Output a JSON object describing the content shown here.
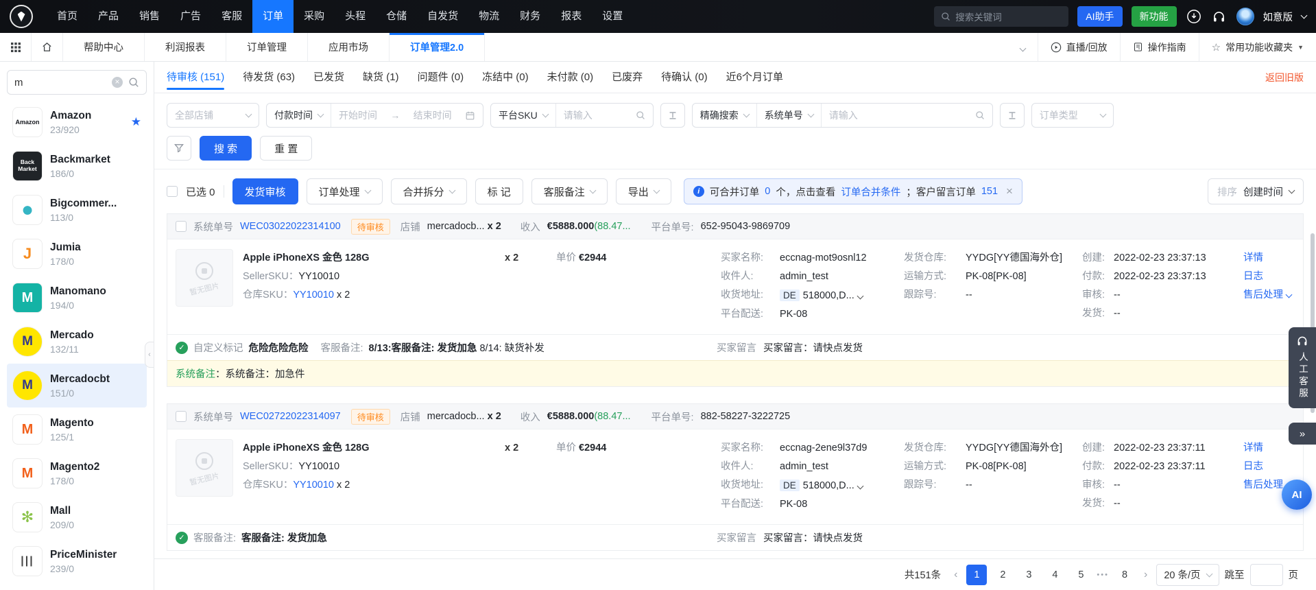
{
  "colors": {
    "accent": "#2468f2",
    "nav_active": "#1677ff",
    "success_green": "#27a05c",
    "badge_orange": "#ff8c21",
    "back_link_orange": "#f2552b",
    "new_feature_green": "#25a244"
  },
  "topnav": {
    "items": [
      "首页",
      "产品",
      "销售",
      "广告",
      "客服",
      "订单",
      "采购",
      "头程",
      "仓储",
      "自发货",
      "物流",
      "财务",
      "报表",
      "设置"
    ],
    "search_placeholder": "搜索关键词",
    "ai_assistant": "AI助手",
    "new_feature": "新功能",
    "edition": "如意版"
  },
  "tabbar": {
    "tabs": [
      "帮助中心",
      "利润报表",
      "订单管理",
      "应用市场",
      "订单管理2.0"
    ],
    "live": "直播/回放",
    "guide": "操作指南",
    "favorites": "常用功能收藏夹"
  },
  "sidebar": {
    "search_value": "m",
    "items": [
      {
        "name": "Amazon",
        "count": "23/920",
        "logo_text": "Amazon",
        "logo_style": "background:#fff;color:#16191f;font-size:9px;font-weight:bold"
      },
      {
        "name": "Backmarket",
        "count": "186/0",
        "logo_text": "Back Market",
        "logo_style": "background:#202428;color:#fff;font-size:8.5px;font-weight:bold;line-height:1.15"
      },
      {
        "name": "Bigcommer...",
        "count": "113/0",
        "logo_text": "●",
        "logo_style": "background:#fff;color:#35b5c4;font-size:30px"
      },
      {
        "name": "Jumia",
        "count": "178/0",
        "logo_text": "J",
        "logo_style": "background:#fff;color:#f68b1e;font-size:22px;font-weight:bold"
      },
      {
        "name": "Manomano",
        "count": "194/0",
        "logo_text": "M",
        "logo_style": "background:#14b3a5;color:#fff;font-size:20px;font-weight:bold"
      },
      {
        "name": "Mercado",
        "count": "132/11",
        "logo_text": "M",
        "logo_style": "background:#ffe600;color:#33398c;font-size:19px;font-weight:bold;border-radius:50%"
      },
      {
        "name": "Mercadocbt",
        "count": "151/0",
        "logo_text": "M",
        "logo_style": "background:#ffe600;color:#33398c;font-size:19px;font-weight:bold;border-radius:50%"
      },
      {
        "name": "Magento",
        "count": "125/1",
        "logo_text": "M",
        "logo_style": "background:#fff;color:#f2611c;font-size:20px;font-weight:bold"
      },
      {
        "name": "Magento2",
        "count": "178/0",
        "logo_text": "M",
        "logo_style": "background:#fff;color:#f2611c;font-size:20px;font-weight:bold"
      },
      {
        "name": "Mall",
        "count": "209/0",
        "logo_text": "✻",
        "logo_style": "background:#fff;color:#8bc34a;font-size:22px"
      },
      {
        "name": "PriceMinister",
        "count": "239/0",
        "logo_text": "|||",
        "logo_style": "background:#fff;color:#444;font-size:16px;font-weight:bold;letter-spacing:2px"
      }
    ]
  },
  "status_tabs": {
    "tabs": [
      "待审核 (151)",
      "待发货 (63)",
      "已发货",
      "缺货 (1)",
      "问题件 (0)",
      "冻结中 (0)",
      "未付款 (0)",
      "已废弃",
      "待确认 (0)",
      "近6个月订单"
    ],
    "back_old": "返回旧版"
  },
  "filters": {
    "shop_all": "全部店铺",
    "pay_time": "付款时间",
    "start_time": "开始时间",
    "range_arrow": "→",
    "end_time": "结束时间",
    "platform_sku": "平台SKU",
    "input_placeholder": "请输入",
    "exact_search": "精确搜索",
    "system_no": "系统单号",
    "order_type": "订单类型",
    "search_btn": "搜 索",
    "reset_btn": "重 置"
  },
  "toolbar": {
    "selected_text": "已选 0",
    "audit": "发货审核",
    "process": "订单处理",
    "merge_split": "合并拆分",
    "mark": "标 记",
    "cs_note": "客服备注",
    "export": "导出",
    "alert": {
      "pre": "可合并订单",
      "count": "0",
      "mid": "个，点击查看",
      "link": "订单合并条件",
      "sep": "；客户留言订单",
      "count2": "151",
      "close": "×"
    },
    "sort_label": "排序",
    "sort_value": "创建时间"
  },
  "orders": [
    {
      "order_no_label": "系统单号",
      "order_no": "WEC03022022314100",
      "status": "待审核",
      "shop_label": "店铺",
      "shop": "mercadocb...",
      "shop_qty": "x 2",
      "income_label": "收入",
      "income": "€5888.000",
      "income_rate": "(88.47...",
      "platform_no_label": "平台单号:",
      "platform_no": "652-95043-9869709",
      "product": {
        "no_image_text": "暂无图片",
        "title": "Apple iPhoneXS 金色 128G",
        "seller_sku_label": "SellerSKU：",
        "seller_sku": "YY10010",
        "wh_sku_label": "仓库SKU：",
        "wh_sku": "YY10010",
        "wh_sku_qty": "x 2",
        "qty": "x 2",
        "price_label": "单价",
        "price": "€2944"
      },
      "buyer": {
        "name_label": "买家名称:",
        "name": "eccnag-mot9osnl12",
        "recipient_label": "收件人:",
        "recipient": "admin_test",
        "address_label": "收货地址:",
        "country": "DE",
        "address": "518000,D...",
        "delivery_label": "平台配送:",
        "delivery": "PK-08"
      },
      "shipping": {
        "warehouse_label": "发货仓库:",
        "warehouse": "YYDG[YY德国海外仓]",
        "method_label": "运输方式:",
        "method": "PK-08[PK-08]",
        "tracking_label": "跟踪号:",
        "tracking": "--"
      },
      "times": {
        "created_label": "创建:",
        "created": "2022-02-23 23:37:13",
        "paid_label": "付款:",
        "paid": "2022-02-23 23:37:13",
        "audited_label": "审核:",
        "audited": "--",
        "shipped_label": "发货:",
        "shipped": "--"
      },
      "links": {
        "detail": "详情",
        "log": "日志",
        "aftersale": "售后处理"
      },
      "tags": {
        "custom_label": "自定义标记",
        "custom_value": "危险危险危险",
        "cs_label": "客服备注:",
        "cs_value_bold": "8/13:客服备注: 发货加急",
        "cs_value_rest": " 8/14: 缺货补发",
        "buyer_label": "买家留言",
        "buyer_value": "买家留言：请快点发货"
      },
      "system_note_label": "系统备注",
      "system_note": "：系统备注：加急件"
    },
    {
      "order_no_label": "系统单号",
      "order_no": "WEC02722022314097",
      "status": "待审核",
      "shop_label": "店铺",
      "shop": "mercadocb...",
      "shop_qty": "x 2",
      "income_label": "收入",
      "income": "€5888.000",
      "income_rate": "(88.47...",
      "platform_no_label": "平台单号:",
      "platform_no": "882-58227-3222725",
      "product": {
        "no_image_text": "暂无图片",
        "title": "Apple iPhoneXS 金色 128G",
        "seller_sku_label": "SellerSKU：",
        "seller_sku": "YY10010",
        "wh_sku_label": "仓库SKU：",
        "wh_sku": "YY10010",
        "wh_sku_qty": "x 2",
        "qty": "x 2",
        "price_label": "单价",
        "price": "€2944"
      },
      "buyer": {
        "name_label": "买家名称:",
        "name": "eccnag-2ene9l37d9",
        "recipient_label": "收件人:",
        "recipient": "admin_test",
        "address_label": "收货地址:",
        "country": "DE",
        "address": "518000,D...",
        "delivery_label": "平台配送:",
        "delivery": "PK-08"
      },
      "shipping": {
        "warehouse_label": "发货仓库:",
        "warehouse": "YYDG[YY德国海外仓]",
        "method_label": "运输方式:",
        "method": "PK-08[PK-08]",
        "tracking_label": "跟踪号:",
        "tracking": "--"
      },
      "times": {
        "created_label": "创建:",
        "created": "2022-02-23 23:37:11",
        "paid_label": "付款:",
        "paid": "2022-02-23 23:37:11",
        "audited_label": "审核:",
        "audited": "--",
        "shipped_label": "发货:",
        "shipped": "--"
      },
      "links": {
        "detail": "详情",
        "log": "日志",
        "aftersale": "售后处理"
      },
      "tags": {
        "cs_label": "客服备注:",
        "cs_value_bold": "客服备注: 发货加急",
        "cs_value_rest": "",
        "buyer_label": "买家留言",
        "buyer_value": "买家留言：请快点发货"
      }
    }
  ],
  "footer": {
    "total": "共151条",
    "prev_icon": "‹",
    "next_icon": "›",
    "pages": [
      "1",
      "2",
      "3",
      "4",
      "5"
    ],
    "ellipsis": "•••",
    "last_page": "8",
    "page_size": "20 条/页",
    "jump_label": "跳至",
    "jump_suffix": "页"
  },
  "floating": {
    "service": "人工客服",
    "more": "»",
    "ai": "AI"
  }
}
